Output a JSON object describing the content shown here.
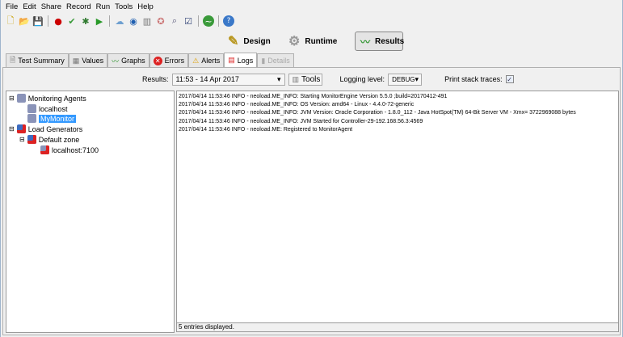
{
  "menu": [
    "File",
    "Edit",
    "Share",
    "Record",
    "Run",
    "Tools",
    "Help"
  ],
  "toolbar_icons": [
    "new-icon",
    "open-icon",
    "save-icon",
    "record-icon",
    "check-icon",
    "debug-icon",
    "run-icon",
    "cloud-icon",
    "clock-icon",
    "servers-icon",
    "award-icon",
    "search-icon",
    "checklist-icon",
    "monitor-icon",
    "help-icon"
  ],
  "modes": [
    {
      "label": "Design"
    },
    {
      "label": "Runtime"
    },
    {
      "label": "Results"
    }
  ],
  "tabs": [
    {
      "label": "Test Summary"
    },
    {
      "label": "Values"
    },
    {
      "label": "Graphs"
    },
    {
      "label": "Errors"
    },
    {
      "label": "Alerts"
    },
    {
      "label": "Logs"
    },
    {
      "label": "Details"
    }
  ],
  "controls": {
    "results_label": "Results:",
    "results_value": "11:53 - 14 Apr 2017",
    "tools_label": "Tools",
    "logging_label": "Logging level:",
    "logging_value": "DEBUG",
    "stack_label": "Print stack traces:",
    "stack_checked": "✓"
  },
  "tree": [
    {
      "label": "Monitoring Agents"
    },
    {
      "label": "localhost"
    },
    {
      "label": "MyMonitor"
    },
    {
      "label": "Load Generators"
    },
    {
      "label": "Default zone"
    },
    {
      "label": "localhost:7100"
    }
  ],
  "log": [
    "2017/04/14 11:53:46 INFO  - neoload.ME_INFO: Starting MonitorEngine Version 5.5.0 ;build=20170412-491",
    "2017/04/14 11:53:46 INFO  - neoload.ME_INFO: OS Version: amd64 - Linux - 4.4.0-72-generic",
    "2017/04/14 11:53:46 INFO  - neoload.ME_INFO: JVM Version: Oracle Corporation - 1.8.0_112 - Java HotSpot(TM) 64-Bit Server VM - Xmx= 3722969088 bytes",
    "2017/04/14 11:53:46 INFO  - neoload.ME_INFO: JVM Started for Controller-29-192.168.56.3:4569",
    "2017/04/14 11:53:46 INFO  - neoload.ME: Registered to MonitorAgent"
  ],
  "status": "5 entries displayed."
}
